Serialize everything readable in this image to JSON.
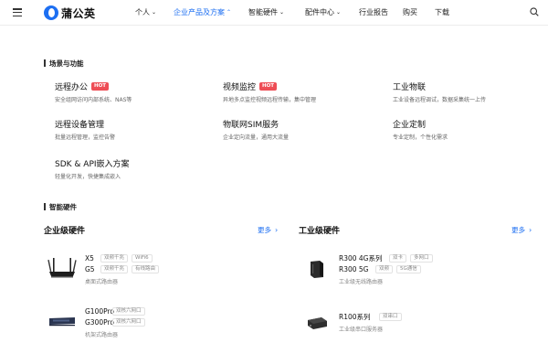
{
  "header": {
    "logo_text": "蒲公英",
    "nav": [
      {
        "label": "个人",
        "caret": true,
        "active": false
      },
      {
        "label": "企业产品及方案",
        "caret": true,
        "active": true
      },
      {
        "label": "智能硬件",
        "caret": true,
        "active": false
      },
      {
        "label": "配件中心",
        "caret": true,
        "active": false
      },
      {
        "label": "行业报告",
        "caret": false,
        "active": false
      },
      {
        "label": "购买",
        "caret": false,
        "active": false
      },
      {
        "label": "下载",
        "caret": false,
        "active": false
      }
    ]
  },
  "scenarios": {
    "title": "场景与功能",
    "items": [
      {
        "title": "远程办公",
        "hot": "HOT",
        "desc": "安全组网访问内部系统、NAS等"
      },
      {
        "title": "视频监控",
        "hot": "HOT",
        "desc": "异地多点监控视频远程传输，集中管理"
      },
      {
        "title": "工业物联",
        "hot": "",
        "desc": "工业设备远程调试，数据采集统一上传"
      },
      {
        "title": "远程设备管理",
        "hot": "",
        "desc": "批量远程管理，监控告警"
      },
      {
        "title": "物联网SIM服务",
        "hot": "",
        "desc": "企业定向流量，通用大流量"
      },
      {
        "title": "企业定制",
        "hot": "",
        "desc": "专业定制，个性化需求"
      },
      {
        "title": "SDK & API嵌入方案",
        "hot": "",
        "desc": "轻量化开发，快捷集成嵌入"
      }
    ]
  },
  "hardware": {
    "title": "智能硬件",
    "more_label": "更多",
    "enterprise": {
      "title": "企业级硬件",
      "products": [
        {
          "rows": [
            {
              "name": "X5",
              "tags": [
                "双频千兆",
                "WiFi6"
              ]
            },
            {
              "name": "G5",
              "tags": [
                "双频千兆",
                "有线路由"
              ]
            }
          ],
          "sub": "桌面式路由器"
        },
        {
          "rows": [
            {
              "name": "G100Pro",
              "tags": [
                "双核六网口"
              ]
            },
            {
              "name": "G300Pro",
              "tags": [
                "双核六网口"
              ]
            }
          ],
          "sub": "机架式路由器"
        }
      ]
    },
    "industrial": {
      "title": "工业级硬件",
      "products": [
        {
          "rows": [
            {
              "name": "R300 4G系列",
              "tags": [
                "双卡",
                "多网口"
              ]
            },
            {
              "name": "R300 5G",
              "tags": [
                "双频",
                "5G通信"
              ]
            }
          ],
          "sub": "工业级无线路由器"
        },
        {
          "rows": [
            {
              "name": "R100系列",
              "tags": [
                "双串口"
              ]
            }
          ],
          "sub": "工业级串口服务器"
        }
      ]
    }
  },
  "colors": {
    "accent": "#1d6ff2",
    "hot": "#ee4d55"
  }
}
